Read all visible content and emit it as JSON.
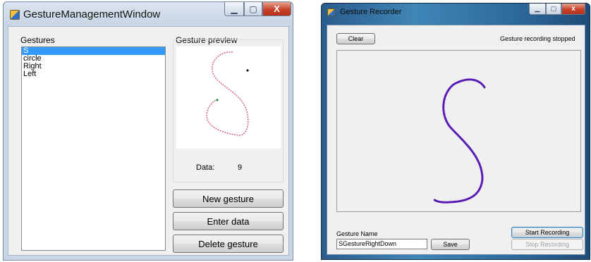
{
  "management_window": {
    "title": "GestureManagementWindow",
    "gestures_label": "Gestures",
    "gestures": [
      {
        "label": "S",
        "selected": true
      },
      {
        "label": "circle",
        "selected": false
      },
      {
        "label": "Right",
        "selected": false
      },
      {
        "label": "Left",
        "selected": false
      }
    ],
    "preview_label": "Gesture preview",
    "data_label": "Data:",
    "data_value": "9",
    "new_gesture_button": "New gesture",
    "enter_data_button": "Enter data",
    "delete_gesture_button": "Delete gesture",
    "minimize_glyph": "▁",
    "maximize_glyph": "▢",
    "close_glyph": "X",
    "stroke_color": "#d36a8a"
  },
  "recorder_window": {
    "title": "Gesture Recorder",
    "clear_button": "Clear",
    "status_text": "Gesture recording stopped",
    "gesture_name_label": "Gesture Name",
    "gesture_name_value": "SGestureRightDown",
    "save_button": "Save",
    "start_recording_button": "Start Recording",
    "stop_recording_button": "Stop Recording",
    "minimize_glyph": "▁",
    "maximize_glyph": "▢",
    "close_glyph": "x",
    "stroke_color": "#5a1bb5"
  },
  "icons": [
    "app-icon",
    "minimize-icon",
    "maximize-icon",
    "close-icon"
  ]
}
